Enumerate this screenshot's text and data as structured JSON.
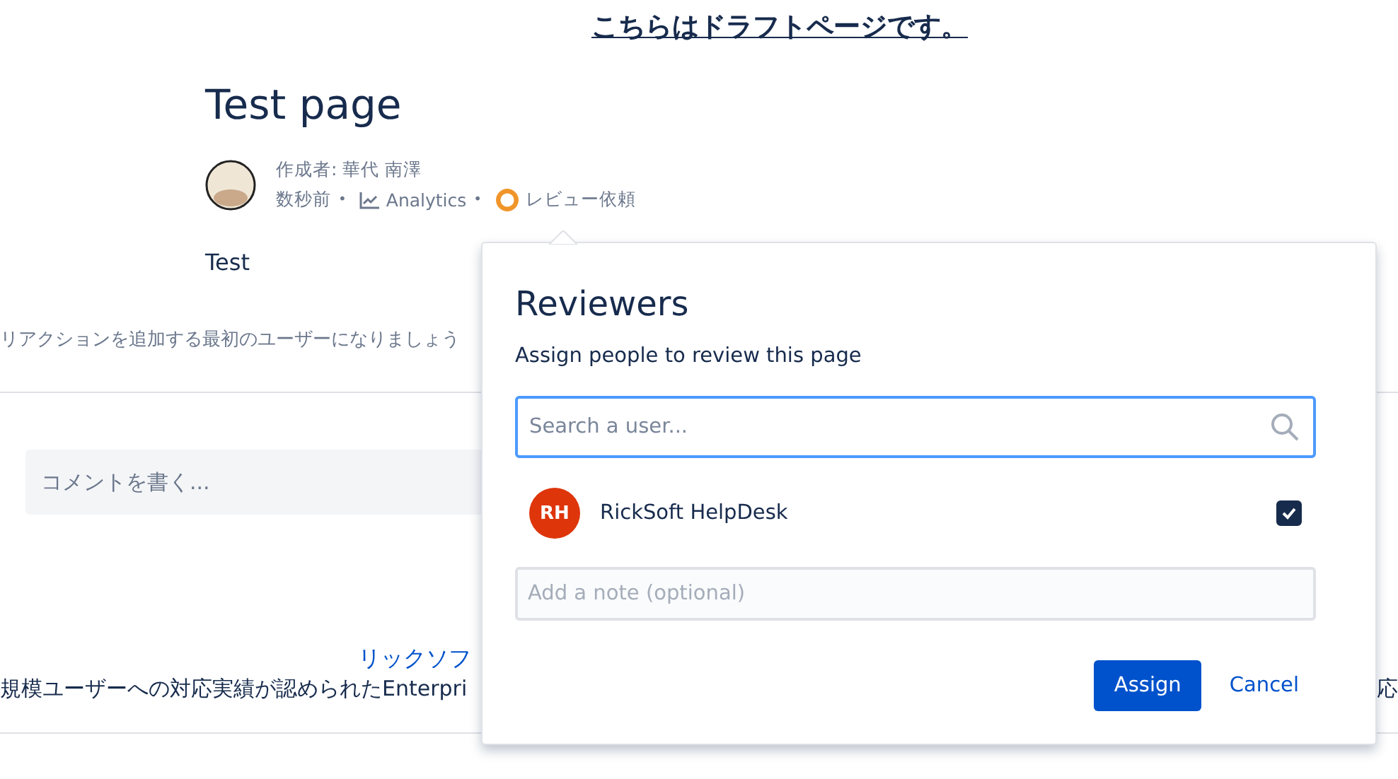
{
  "banner": "こちらはドラフトページです。",
  "page": {
    "title": "Test page",
    "byline": "作成者: 華代 南澤",
    "time": "数秒前",
    "separator": "•",
    "analytics": "Analytics",
    "review": "レビュー依頼",
    "body": "Test",
    "reactions": "リアクションを追加する最初のユーザーになりましょう"
  },
  "comment": {
    "placeholder": "コメントを書く..."
  },
  "footer": {
    "link": "リックソフ",
    "text": "規模ユーザーへの対応実績が認められたEnterpri",
    "text_right": "応"
  },
  "popup": {
    "title": "Reviewers",
    "subtitle": "Assign people to review this page",
    "search": {
      "placeholder": "Search a user..."
    },
    "users": [
      {
        "initials": "RH",
        "name": "RickSoft HelpDesk",
        "checked": true,
        "color": "#de350b"
      }
    ],
    "note": {
      "placeholder": "Add a note (optional)"
    },
    "buttons": [
      {
        "label": "Assign",
        "kind": "primary"
      },
      {
        "label": "Cancel",
        "kind": "link"
      }
    ]
  }
}
